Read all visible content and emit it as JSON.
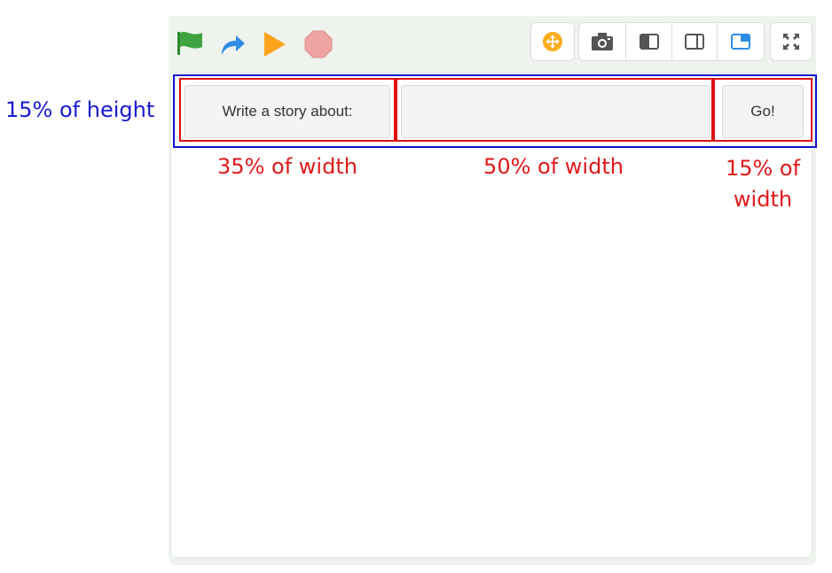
{
  "toolbar": {
    "run_controls": [
      "green-flag-icon",
      "redo-arrow-icon",
      "play-icon",
      "stop-icon"
    ],
    "view_buttons": [
      "move-icon",
      "camera-icon",
      "layout-left-icon",
      "layout-right-icon",
      "layout-overlay-icon"
    ],
    "fullscreen": "fullscreen-icon"
  },
  "story": {
    "label": "Write a story about:",
    "input_value": "",
    "go_label": "Go!"
  },
  "annotations": {
    "height_note": "15% of height",
    "col1_note": "35% of width",
    "col2_note": "50% of width",
    "col3_note_line1": "15% of",
    "col3_note_line2": "width"
  },
  "colors": {
    "blue_outline": "#1010d0",
    "red_outline": "#e01010",
    "flag": "#3fa33f",
    "arrow": "#2f8de4",
    "play": "#ffa21c",
    "stop": "#eea3a3",
    "move": "#ffab19",
    "layout_active": "#2f8de4"
  }
}
